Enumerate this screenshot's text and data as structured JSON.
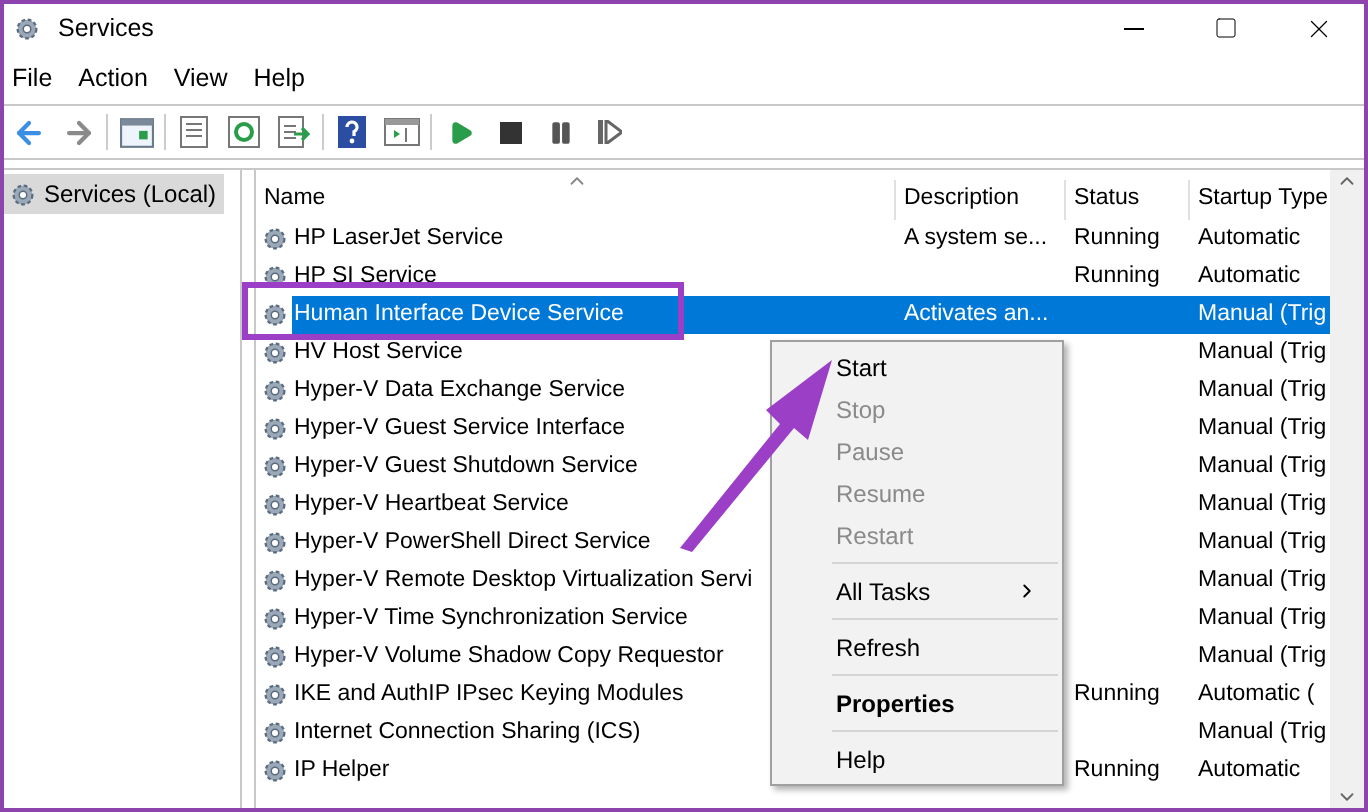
{
  "window": {
    "title": "Services"
  },
  "menu_bar": [
    "File",
    "Action",
    "View",
    "Help"
  ],
  "sidebar": {
    "items": [
      {
        "label": "Services (Local)",
        "selected": true
      }
    ]
  },
  "table": {
    "columns": [
      "Name",
      "Description",
      "Status",
      "Startup Type"
    ],
    "rows": [
      {
        "name": "HP LaserJet Service",
        "description": "A system se...",
        "status": "Running",
        "startup": "Automatic",
        "selected": false
      },
      {
        "name": "HP SI Service",
        "description": "",
        "status": "Running",
        "startup": "Automatic",
        "selected": false
      },
      {
        "name": "Human Interface Device Service",
        "description": "Activates an...",
        "status": "",
        "startup": "Manual (Trig",
        "selected": true
      },
      {
        "name": "HV Host Service",
        "description": "",
        "status": "",
        "startup": "Manual (Trig",
        "selected": false
      },
      {
        "name": "Hyper-V Data Exchange Service",
        "description": "",
        "status": "",
        "startup": "Manual (Trig",
        "selected": false
      },
      {
        "name": "Hyper-V Guest Service Interface",
        "description": "",
        "status": "",
        "startup": "Manual (Trig",
        "selected": false
      },
      {
        "name": "Hyper-V Guest Shutdown Service",
        "description": "",
        "status": "",
        "startup": "Manual (Trig",
        "selected": false
      },
      {
        "name": "Hyper-V Heartbeat Service",
        "description": "",
        "status": "",
        "startup": "Manual (Trig",
        "selected": false
      },
      {
        "name": "Hyper-V PowerShell Direct Service",
        "description": "",
        "status": "",
        "startup": "Manual (Trig",
        "selected": false
      },
      {
        "name": "Hyper-V Remote Desktop Virtualization Servi",
        "description": "",
        "status": "",
        "startup": "Manual (Trig",
        "selected": false
      },
      {
        "name": "Hyper-V Time Synchronization Service",
        "description": "",
        "status": "",
        "startup": "Manual (Trig",
        "selected": false
      },
      {
        "name": "Hyper-V Volume Shadow Copy Requestor",
        "description": "",
        "status": "",
        "startup": "Manual (Trig",
        "selected": false
      },
      {
        "name": "IKE and AuthIP IPsec Keying Modules",
        "description": "",
        "status": "Running",
        "startup": "Automatic (",
        "selected": false
      },
      {
        "name": "Internet Connection Sharing (ICS)",
        "description": "",
        "status": "",
        "startup": "Manual (Trig",
        "selected": false
      },
      {
        "name": "IP Helper",
        "description": "",
        "status": "Running",
        "startup": "Automatic",
        "selected": false
      }
    ]
  },
  "context_menu": {
    "items": [
      {
        "kind": "item",
        "label": "Start",
        "disabled": false,
        "bold": false,
        "submenu": false
      },
      {
        "kind": "item",
        "label": "Stop",
        "disabled": true,
        "bold": false,
        "submenu": false
      },
      {
        "kind": "item",
        "label": "Pause",
        "disabled": true,
        "bold": false,
        "submenu": false
      },
      {
        "kind": "item",
        "label": "Resume",
        "disabled": true,
        "bold": false,
        "submenu": false
      },
      {
        "kind": "item",
        "label": "Restart",
        "disabled": true,
        "bold": false,
        "submenu": false
      },
      {
        "kind": "separator"
      },
      {
        "kind": "item",
        "label": "All Tasks",
        "disabled": false,
        "bold": false,
        "submenu": true
      },
      {
        "kind": "separator"
      },
      {
        "kind": "item",
        "label": "Refresh",
        "disabled": false,
        "bold": false,
        "submenu": false
      },
      {
        "kind": "separator"
      },
      {
        "kind": "item",
        "label": "Properties",
        "disabled": false,
        "bold": true,
        "submenu": false
      },
      {
        "kind": "separator"
      },
      {
        "kind": "item",
        "label": "Help",
        "disabled": false,
        "bold": false,
        "submenu": false
      }
    ]
  },
  "annotations": {
    "highlight_box": true,
    "arrow": true
  }
}
